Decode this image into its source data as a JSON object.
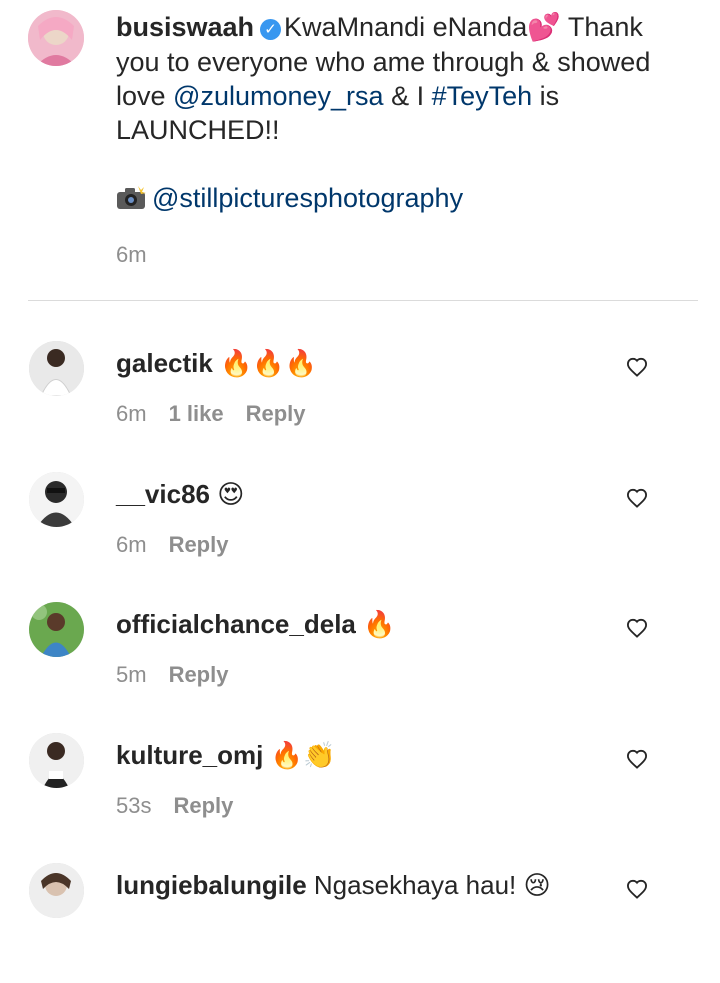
{
  "caption": {
    "username": "busiswaah",
    "verified_mark": "✓",
    "text_part1": "KwaMnandi eNanda",
    "heart_emoji": "💕",
    "text_part2": " Thank you to everyone who ame through & showed love ",
    "mention1": "@zulumoney_rsa",
    "text_part3": " & I ",
    "hashtag": "#TeyTeh",
    "text_part4": " is LAUNCHED!!",
    "photo_credit": "@stillpicturesphotography",
    "time": "6m"
  },
  "comments": [
    {
      "username": "galectik",
      "text": "",
      "emoji": "🔥🔥🔥",
      "time": "6m",
      "likes": "1 like",
      "reply": "Reply"
    },
    {
      "username": "__vic86",
      "text": "",
      "emoji": "😍",
      "time": "6m",
      "likes": "",
      "reply": "Reply"
    },
    {
      "username": "officialchance_dela",
      "text": "",
      "emoji": "🔥",
      "time": "5m",
      "likes": "",
      "reply": "Reply"
    },
    {
      "username": "kulture_omj",
      "text": "",
      "emoji": "🔥👏",
      "time": "53s",
      "likes": "",
      "reply": "Reply"
    },
    {
      "username": "lungiebalungile",
      "text": "Ngasekhaya hau!",
      "emoji": "😢",
      "time": "",
      "likes": "",
      "reply": ""
    }
  ],
  "icons": {
    "like": "heart-outline-icon",
    "verified": "verified-badge-icon",
    "camera": "camera-flash-icon"
  },
  "colors": {
    "link": "#00376b",
    "muted": "#8e8e8e",
    "verified": "#3897f0"
  }
}
